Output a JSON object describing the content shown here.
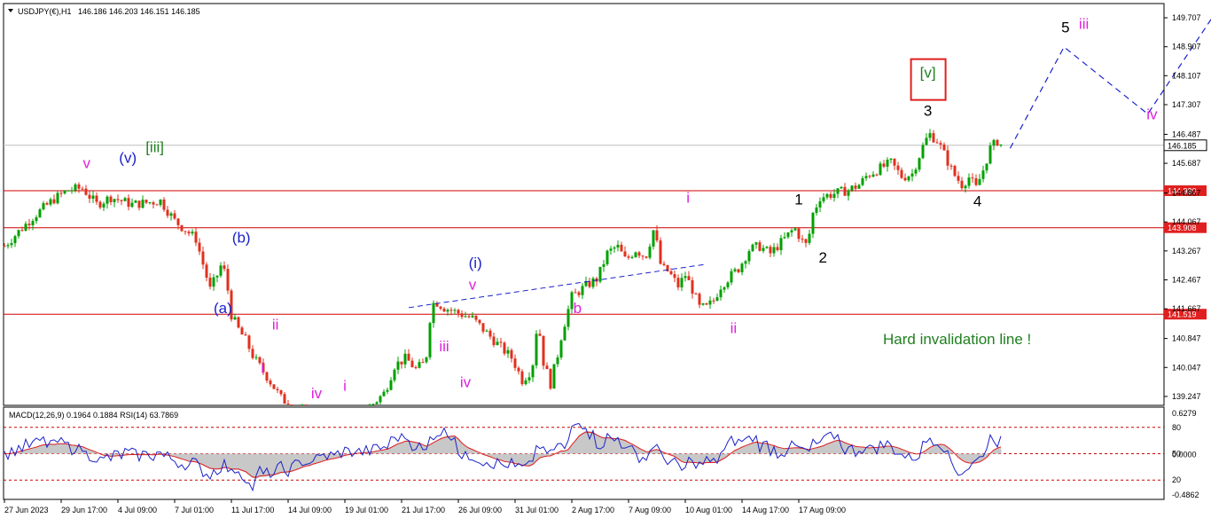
{
  "header": {
    "symbol": "USDJPY(€),H1",
    "ohlc": "146.186 146.203 146.151 146.185"
  },
  "indicator": {
    "label": "MACD(12,26,9) 0.1964 0.1884  RSI(14) 63.7869"
  },
  "annotation_text": "Hard invalidation line !",
  "colors": {
    "bull": "#00a000",
    "bear": "#e0301e",
    "level": "#d00000",
    "magenta": "#e020e0",
    "blue": "#1a22c8",
    "green": "#208020",
    "black": "#000000",
    "price_tag_bg": "#e02020",
    "current_tag_bg": "#ffffff"
  },
  "chart_data": {
    "type": "candlestick",
    "price_axis": {
      "range": [
        139.0,
        150.1
      ],
      "ticks": [
        "149.707",
        "148.907",
        "148.107",
        "147.307",
        "146.487",
        "145.687",
        "144.867",
        "144.067",
        "143.267",
        "142.467",
        "141.667",
        "140.847",
        "140.047",
        "139.247"
      ]
    },
    "time_axis": {
      "ticks": [
        "27 Jun 2023",
        "29 Jun 17:00",
        "4 Jul 09:00",
        "7 Jul 01:00",
        "11 Jul 17:00",
        "14 Jul 09:00",
        "19 Jul 01:00",
        "21 Jul 17:00",
        "26 Jul 09:00",
        "31 Jul 01:00",
        "2 Aug 17:00",
        "7 Aug 09:00",
        "10 Aug 01:00",
        "14 Aug 17:00",
        "17 Aug 09:00"
      ]
    },
    "current_price": "146.185",
    "levels": [
      {
        "label": "144.930",
        "value": 144.93
      },
      {
        "label": "143.908",
        "value": 143.908
      },
      {
        "label": "141.519",
        "value": 141.519
      }
    ],
    "price_path": [
      {
        "x": 0.0,
        "p": 143.4
      },
      {
        "x": 2.0,
        "p": 144.2
      },
      {
        "x": 3.5,
        "p": 144.7
      },
      {
        "x": 4.5,
        "p": 144.95
      },
      {
        "x": 5.5,
        "p": 145.0
      },
      {
        "x": 6.5,
        "p": 144.55
      },
      {
        "x": 7.5,
        "p": 144.75
      },
      {
        "x": 9.0,
        "p": 144.55
      },
      {
        "x": 11.0,
        "p": 144.65
      },
      {
        "x": 12.0,
        "p": 144.1
      },
      {
        "x": 13.5,
        "p": 143.6
      },
      {
        "x": 14.5,
        "p": 142.2
      },
      {
        "x": 15.0,
        "p": 142.6
      },
      {
        "x": 15.3,
        "p": 142.9
      },
      {
        "x": 15.6,
        "p": 142.6
      },
      {
        "x": 16.0,
        "p": 141.5
      },
      {
        "x": 16.5,
        "p": 141.1
      },
      {
        "x": 17.0,
        "p": 140.8
      },
      {
        "x": 17.6,
        "p": 140.3
      },
      {
        "x": 18.5,
        "p": 139.8
      },
      {
        "x": 19.5,
        "p": 139.2
      },
      {
        "x": 20.5,
        "p": 138.9
      },
      {
        "x": 22.0,
        "p": 138.6
      },
      {
        "x": 23.5,
        "p": 138.7
      },
      {
        "x": 25.5,
        "p": 138.85
      },
      {
        "x": 26.8,
        "p": 139.35
      },
      {
        "x": 27.5,
        "p": 140.1
      },
      {
        "x": 28.3,
        "p": 140.3
      },
      {
        "x": 29.0,
        "p": 140.0
      },
      {
        "x": 29.7,
        "p": 140.2
      },
      {
        "x": 30.0,
        "p": 141.4
      },
      {
        "x": 30.3,
        "p": 141.9
      },
      {
        "x": 31.0,
        "p": 141.7
      },
      {
        "x": 32.0,
        "p": 141.55
      },
      {
        "x": 33.0,
        "p": 141.4
      },
      {
        "x": 34.0,
        "p": 141.0
      },
      {
        "x": 35.0,
        "p": 140.6
      },
      {
        "x": 35.8,
        "p": 140.3
      },
      {
        "x": 36.5,
        "p": 139.7
      },
      {
        "x": 37.2,
        "p": 140.0
      },
      {
        "x": 37.6,
        "p": 141.4
      },
      {
        "x": 38.0,
        "p": 140.2
      },
      {
        "x": 38.5,
        "p": 139.6
      },
      {
        "x": 39.0,
        "p": 140.4
      },
      {
        "x": 39.3,
        "p": 141.0
      },
      {
        "x": 40.0,
        "p": 142.0
      },
      {
        "x": 41.0,
        "p": 142.3
      },
      {
        "x": 41.8,
        "p": 142.5
      },
      {
        "x": 42.5,
        "p": 143.2
      },
      {
        "x": 43.2,
        "p": 143.4
      },
      {
        "x": 43.8,
        "p": 143.0
      },
      {
        "x": 44.5,
        "p": 143.3
      },
      {
        "x": 45.2,
        "p": 143.1
      },
      {
        "x": 45.8,
        "p": 143.9
      },
      {
        "x": 46.3,
        "p": 142.8
      },
      {
        "x": 46.8,
        "p": 142.7
      },
      {
        "x": 47.5,
        "p": 142.3
      },
      {
        "x": 48.0,
        "p": 142.6
      },
      {
        "x": 48.5,
        "p": 142.2
      },
      {
        "x": 49.0,
        "p": 141.7
      },
      {
        "x": 49.5,
        "p": 141.7
      },
      {
        "x": 50.0,
        "p": 141.9
      },
      {
        "x": 50.5,
        "p": 142.3
      },
      {
        "x": 51.0,
        "p": 142.5
      },
      {
        "x": 51.8,
        "p": 142.8
      },
      {
        "x": 52.5,
        "p": 143.3
      },
      {
        "x": 53.2,
        "p": 143.4
      },
      {
        "x": 54.0,
        "p": 143.2
      },
      {
        "x": 55.0,
        "p": 143.6
      },
      {
        "x": 55.7,
        "p": 143.9
      },
      {
        "x": 56.3,
        "p": 143.5
      },
      {
        "x": 56.6,
        "p": 143.4
      },
      {
        "x": 57.0,
        "p": 144.3
      },
      {
        "x": 57.5,
        "p": 144.75
      },
      {
        "x": 58.5,
        "p": 144.85
      },
      {
        "x": 59.5,
        "p": 144.95
      },
      {
        "x": 60.3,
        "p": 145.1
      },
      {
        "x": 60.8,
        "p": 145.35
      },
      {
        "x": 61.5,
        "p": 145.5
      },
      {
        "x": 62.5,
        "p": 145.7
      },
      {
        "x": 63.3,
        "p": 145.3
      },
      {
        "x": 64.0,
        "p": 145.4
      },
      {
        "x": 64.8,
        "p": 146.2
      },
      {
        "x": 65.2,
        "p": 146.5
      },
      {
        "x": 65.8,
        "p": 146.3
      },
      {
        "x": 66.3,
        "p": 145.9
      },
      {
        "x": 66.9,
        "p": 145.4
      },
      {
        "x": 67.5,
        "p": 145.1
      },
      {
        "x": 68.0,
        "p": 145.3
      },
      {
        "x": 68.5,
        "p": 145.0
      },
      {
        "x": 69.0,
        "p": 145.5
      },
      {
        "x": 69.5,
        "p": 146.1
      },
      {
        "x": 70.0,
        "p": 146.3
      },
      {
        "x": 70.3,
        "p": 146.185
      }
    ],
    "projection": [
      {
        "x": 70.9,
        "p": 146.1
      },
      {
        "x": 74.7,
        "p": 148.9
      },
      {
        "x": 80.6,
        "p": 147.05
      },
      {
        "x": 85.3,
        "p": 149.8
      }
    ],
    "trendline": [
      {
        "x": 28.5,
        "p": 141.7
      },
      {
        "x": 49.5,
        "p": 142.9
      }
    ],
    "wave_labels": [
      {
        "text": "v",
        "color": "magenta",
        "x": 5.8,
        "p": 145.55
      },
      {
        "text": "(v)",
        "color": "blue",
        "x": 8.7,
        "p": 145.7
      },
      {
        "text": "[iii]",
        "color": "green",
        "x": 10.6,
        "p": 146.0
      },
      {
        "text": "(b)",
        "color": "blue",
        "x": 16.7,
        "p": 143.5
      },
      {
        "text": "(a)",
        "color": "blue",
        "x": 15.4,
        "p": 141.55
      },
      {
        "text": "ii",
        "color": "magenta",
        "x": 19.1,
        "p": 141.1
      },
      {
        "text": "i",
        "color": "magenta",
        "x": 18.2,
        "p": 139.9
      },
      {
        "text": "iv",
        "color": "magenta",
        "x": 22.0,
        "p": 139.2
      },
      {
        "text": "i",
        "color": "magenta",
        "x": 24.0,
        "p": 139.4
      },
      {
        "text": "(i)",
        "color": "blue",
        "x": 33.2,
        "p": 142.8
      },
      {
        "text": "v",
        "color": "magenta",
        "x": 33.0,
        "p": 142.2
      },
      {
        "text": "iii",
        "color": "magenta",
        "x": 31.0,
        "p": 140.5
      },
      {
        "text": "iv",
        "color": "magenta",
        "x": 32.5,
        "p": 139.5
      },
      {
        "text": "b",
        "color": "magenta",
        "x": 40.4,
        "p": 141.55
      },
      {
        "text": "i",
        "color": "magenta",
        "x": 48.2,
        "p": 144.6
      },
      {
        "text": "ii",
        "color": "magenta",
        "x": 51.4,
        "p": 141.0
      },
      {
        "text": "1",
        "color": "black",
        "x": 56.0,
        "p": 144.55
      },
      {
        "text": "2",
        "color": "black",
        "x": 57.7,
        "p": 142.95
      },
      {
        "text": "3",
        "color": "black",
        "x": 65.1,
        "p": 147.0
      },
      {
        "text": "4",
        "color": "black",
        "x": 68.6,
        "p": 144.5
      },
      {
        "text": "5",
        "color": "black",
        "x": 74.8,
        "p": 149.3
      },
      {
        "text": "iii",
        "color": "magenta",
        "x": 76.1,
        "p": 149.4
      },
      {
        "text": "iv",
        "color": "magenta",
        "x": 80.9,
        "p": 146.9
      },
      {
        "text": "[v]",
        "color": "green",
        "x": 65.1,
        "p": 148.05,
        "boxed": true
      }
    ],
    "indicator_axis": {
      "ticks": [
        "0.6279",
        "80",
        "50",
        "0.0000",
        "20",
        "-0.4862"
      ],
      "levels": [
        80,
        50,
        20
      ]
    }
  }
}
